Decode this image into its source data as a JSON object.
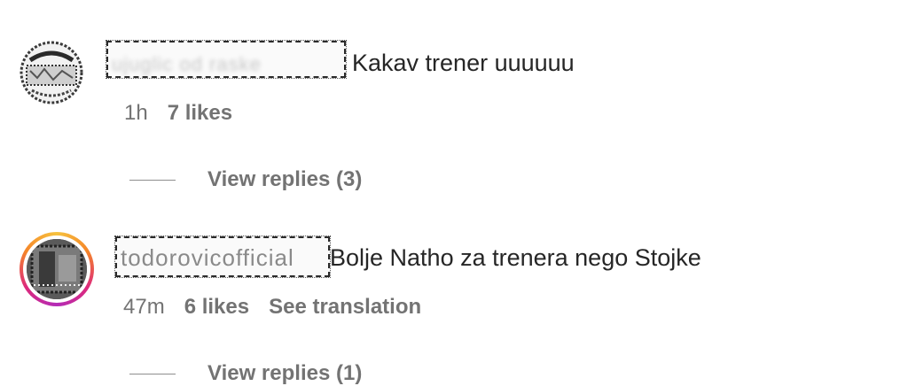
{
  "comments": [
    {
      "username": "ujuglic od raske",
      "text": "Kakav trener uuuuuu",
      "time": "1h",
      "likes": "7 likes",
      "replies": "View replies (3)",
      "avatar_icon": "avatar-stamp-icon"
    },
    {
      "username": "todorovicofficial",
      "text": "Bolje Natho za trenera nego Stojke",
      "time": "47m",
      "likes": "6 likes",
      "translation": "See translation",
      "replies": "View replies (1)",
      "avatar_icon": "avatar-story-ring-icon"
    }
  ],
  "colors": {
    "text": "#262626",
    "meta": "#737373",
    "story_ring_start": "#f6c23e",
    "story_ring_mid": "#dd2a7b",
    "story_ring_end": "#b32bb7"
  }
}
